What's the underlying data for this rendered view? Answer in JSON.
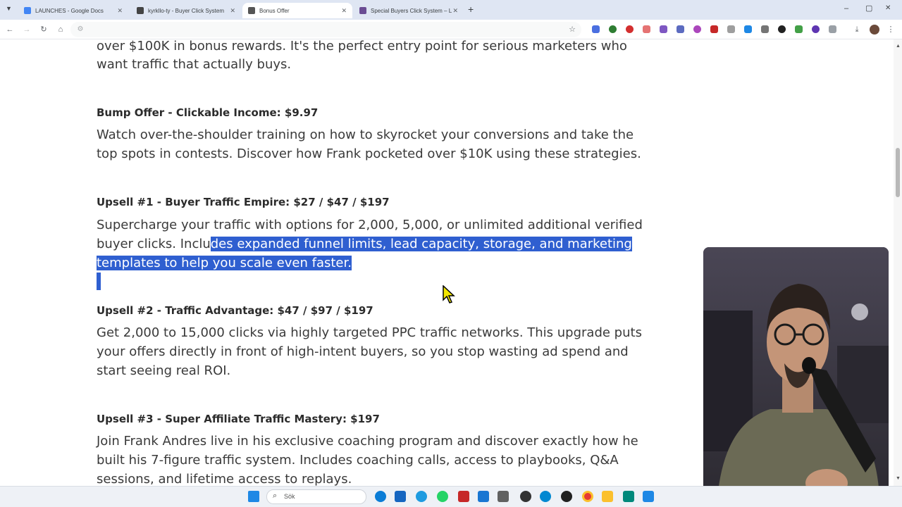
{
  "browser": {
    "tabs": [
      {
        "title": "LAUNCHES - Google Docs",
        "favicon_color": "#4285f4",
        "active": false
      },
      {
        "title": "kyrkllo-ty - Buyer Click System",
        "favicon_color": "#444444",
        "active": false
      },
      {
        "title": "Bonus Offer",
        "favicon_color": "#555555",
        "active": true
      },
      {
        "title": "Special Buyers Click System – L",
        "favicon_color": "#6a4c93",
        "active": false
      }
    ],
    "new_tab_label": "+",
    "window_controls": [
      "–",
      "▢",
      "✕"
    ]
  },
  "article": {
    "intro_lines": [
      "over $100K in bonus rewards. It's the perfect entry point for serious marketers who",
      "want traffic that actually buys."
    ],
    "bump": {
      "heading": "Bump Offer - Clickable Income: $9.97",
      "lines": [
        "Watch over-the-shoulder training on how to skyrocket your conversions and take the",
        "top spots in contests. Discover how Frank pocketed over $10K using these strategies."
      ]
    },
    "upsell1": {
      "heading": "Upsell #1 - Buyer Traffic Empire: $27 / $47 / $197",
      "line1": "Supercharge your traffic with options for 2,000, 5,000, or unlimited additional verified",
      "line2_plain": "buyer clicks. Inclu",
      "line2_selected": "des expanded funnel limits, lead capacity, storage, and marketing",
      "line3_selected": "templates to help you scale even faster."
    },
    "upsell2": {
      "heading": "Upsell #2 - Traffic Advantage: $47 / $97 / $197",
      "lines": [
        "Get 2,000 to 15,000 clicks via highly targeted PPC traffic networks. This upgrade puts",
        "your offers directly in front of high-intent buyers, so you stop wasting ad spend and",
        "start seeing real ROI."
      ]
    },
    "upsell3": {
      "heading": "Upsell #3 - Super Affiliate Traffic Mastery: $197",
      "lines": [
        "Join Frank Andres live in his exclusive coaching program and discover exactly how he",
        "built his 7-figure traffic system. Includes coaching calls, access to playbooks, Q&A",
        "sessions, and lifetime access to replays."
      ]
    }
  },
  "taskbar": {
    "search_placeholder": "Sök"
  },
  "colors": {
    "selection": "#2f5fd0",
    "tabbar": "#dfe6f3"
  }
}
